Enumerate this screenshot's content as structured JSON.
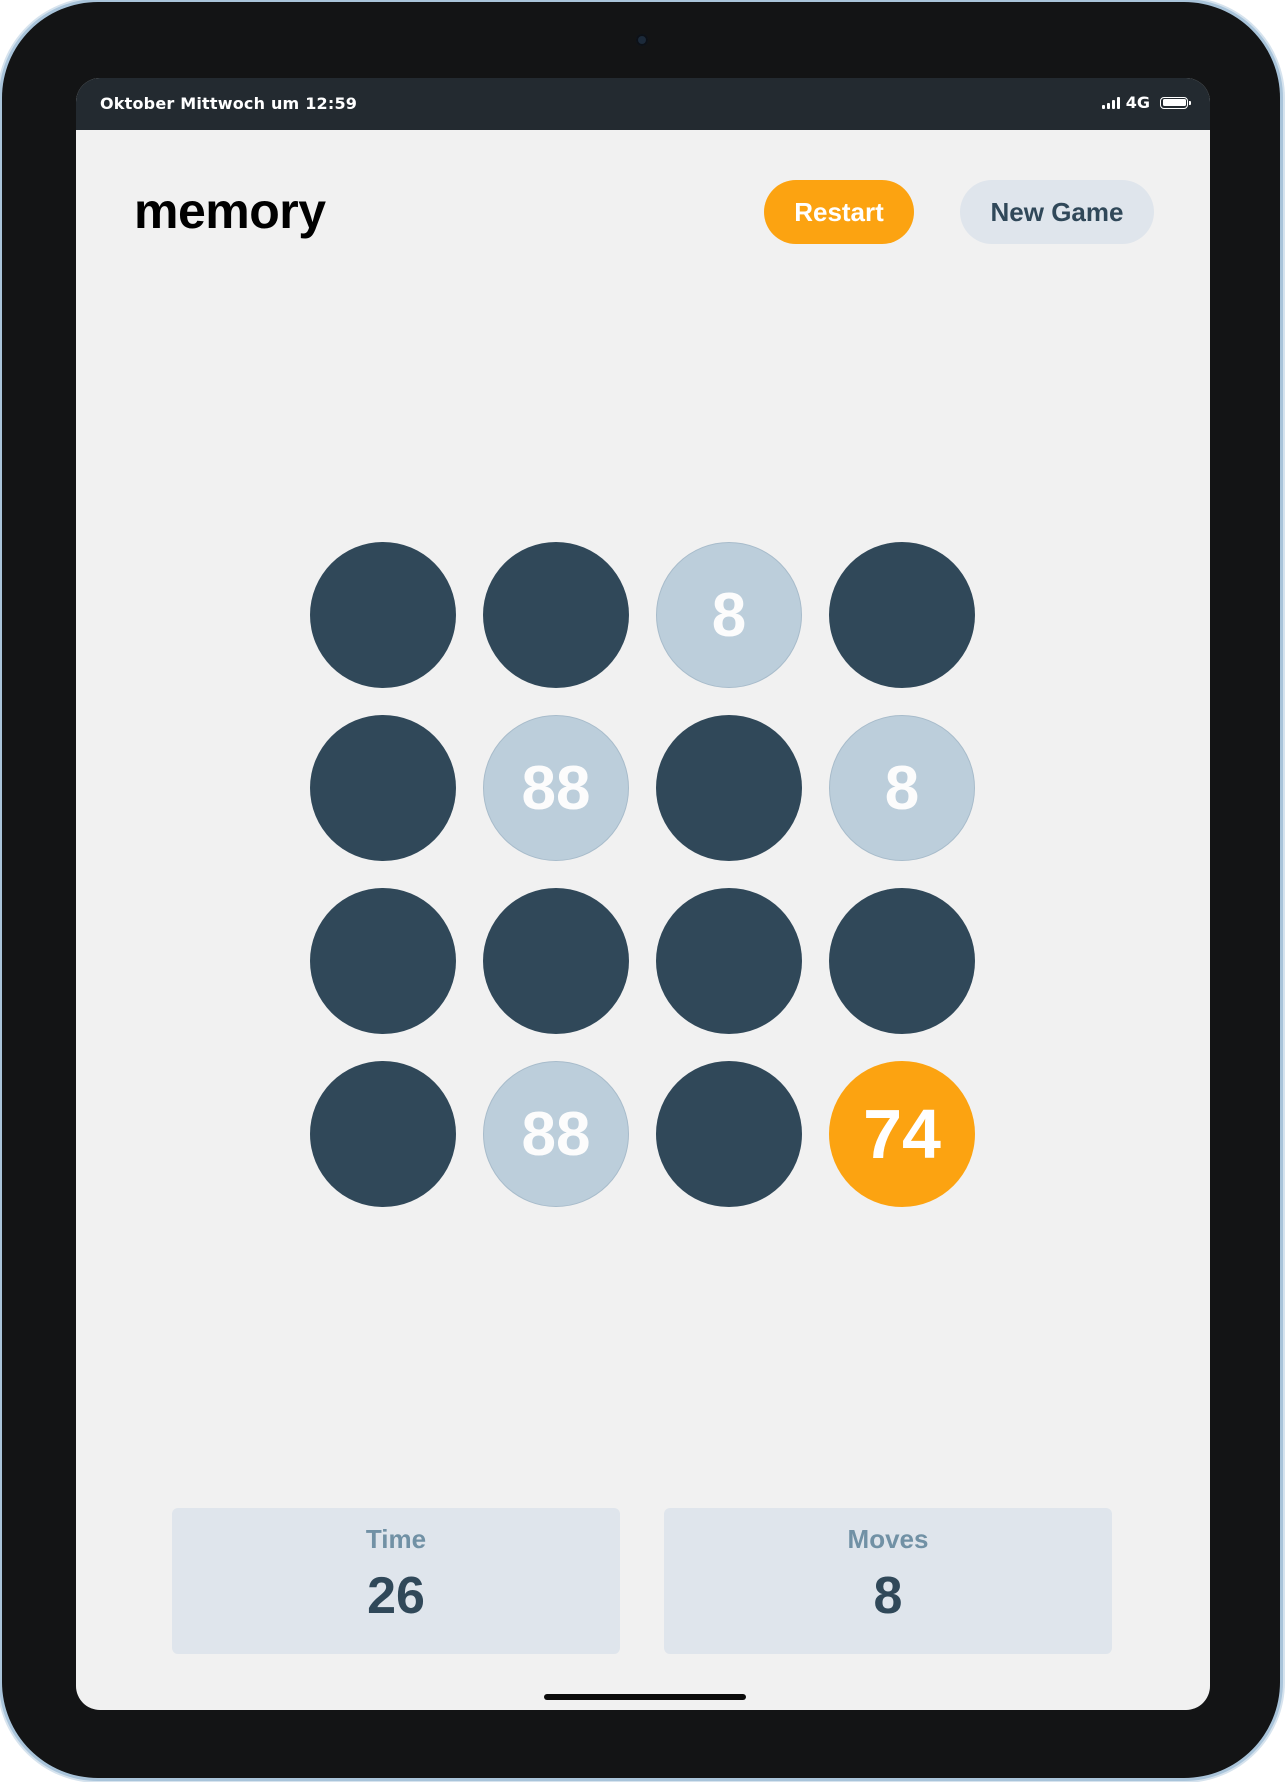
{
  "status_bar": {
    "datetime": "Oktober Mittwoch um 12:59",
    "network": "4G",
    "icons": [
      "signal-icon",
      "battery-icon"
    ]
  },
  "header": {
    "title": "memory",
    "restart_label": "Restart",
    "new_game_label": "New Game"
  },
  "colors": {
    "accent": "#fca311",
    "tile_hidden": "#304859",
    "tile_matched": "#bccedb",
    "panel": "#dfe5ec",
    "background": "#f1f1f1"
  },
  "board": {
    "rows": 4,
    "cols": 4,
    "tiles": [
      {
        "state": "hidden",
        "value": ""
      },
      {
        "state": "hidden",
        "value": ""
      },
      {
        "state": "matched",
        "value": "8"
      },
      {
        "state": "hidden",
        "value": ""
      },
      {
        "state": "hidden",
        "value": ""
      },
      {
        "state": "matched",
        "value": "88"
      },
      {
        "state": "hidden",
        "value": ""
      },
      {
        "state": "matched",
        "value": "8"
      },
      {
        "state": "hidden",
        "value": ""
      },
      {
        "state": "hidden",
        "value": ""
      },
      {
        "state": "hidden",
        "value": ""
      },
      {
        "state": "hidden",
        "value": ""
      },
      {
        "state": "hidden",
        "value": ""
      },
      {
        "state": "matched",
        "value": "88"
      },
      {
        "state": "hidden",
        "value": ""
      },
      {
        "state": "active",
        "value": "74"
      }
    ]
  },
  "stats": {
    "time_label": "Time",
    "time_value": "26",
    "moves_label": "Moves",
    "moves_value": "8"
  }
}
